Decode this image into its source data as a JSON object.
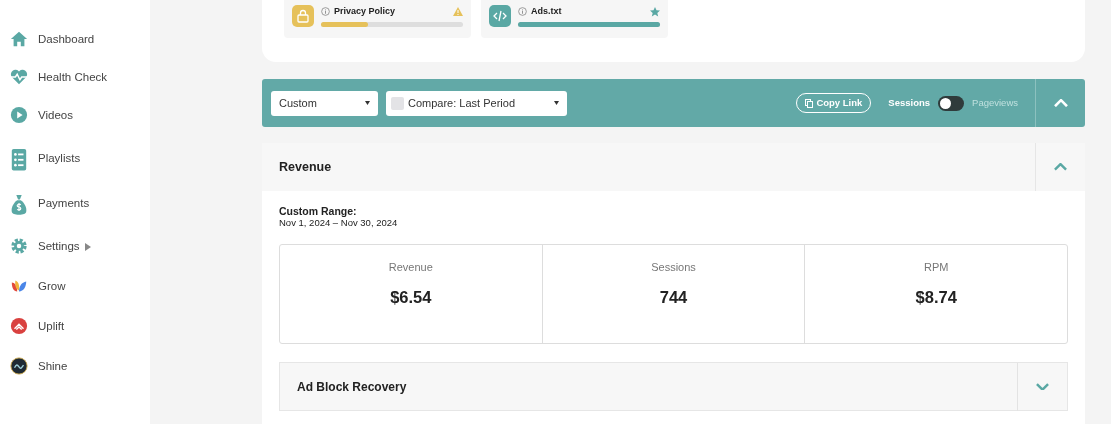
{
  "sidebar": {
    "items": [
      {
        "label": "Dashboard",
        "has_submenu": false
      },
      {
        "label": "Health Check",
        "has_submenu": false
      },
      {
        "label": "Videos",
        "has_submenu": false
      },
      {
        "label": "Playlists",
        "has_submenu": false
      },
      {
        "label": "Payments",
        "has_submenu": false
      },
      {
        "label": "Settings",
        "has_submenu": true
      },
      {
        "label": "Grow",
        "has_submenu": false
      },
      {
        "label": "Uplift",
        "has_submenu": false
      },
      {
        "label": "Shine",
        "has_submenu": false
      }
    ]
  },
  "health_tiles": [
    {
      "label": "Privacy Policy",
      "kind": "warning",
      "level": 0.33,
      "color": "#e6c15a"
    },
    {
      "label": "Ads.txt",
      "kind": "star",
      "level": 1,
      "color": "#5aa8a4"
    }
  ],
  "toolbar": {
    "range_select": "Custom",
    "compare_select": "Compare: Last Period",
    "copy_link": "Copy Link",
    "metric_toggle": [
      {
        "label": "Sessions",
        "selected": true
      },
      {
        "label": "Pageviews",
        "selected": false
      }
    ],
    "expanded": true
  },
  "revenue_panel": {
    "title": "Revenue",
    "expanded": true,
    "range_label": "Custom Range:",
    "range": "Nov 1, 2024 – Nov 30, 2024",
    "metrics": [
      {
        "label": "Revenue",
        "value": "$6.54"
      },
      {
        "label": "Sessions",
        "value": "744"
      },
      {
        "label": "RPM",
        "value": "$8.74"
      }
    ]
  },
  "sub_panels": [
    {
      "title": "Ad Block Recovery",
      "expanded": false
    }
  ]
}
